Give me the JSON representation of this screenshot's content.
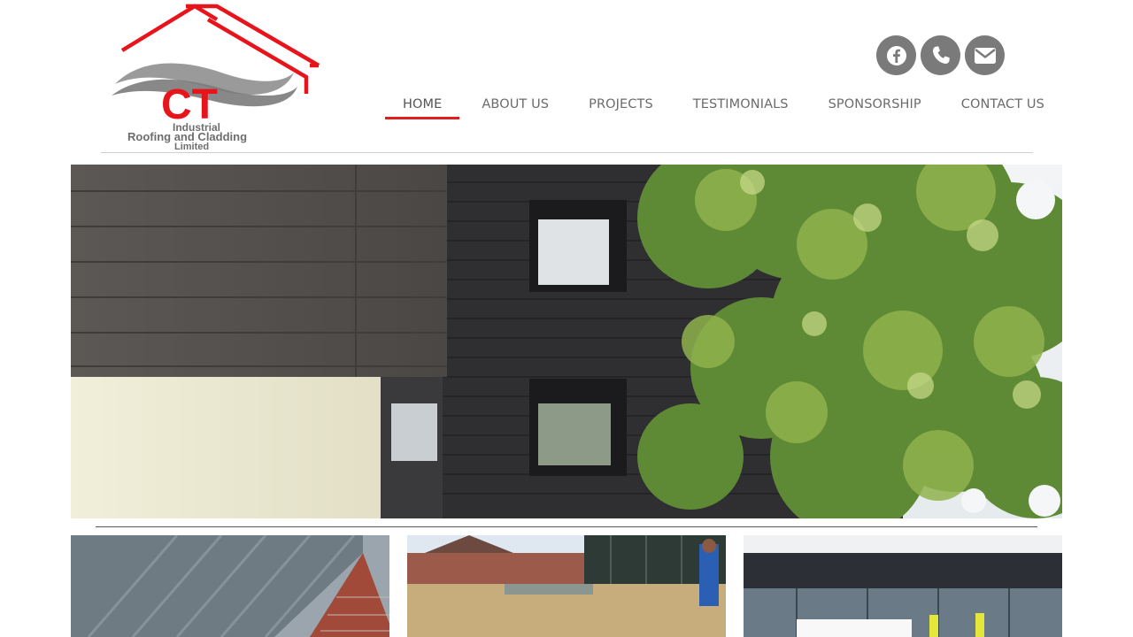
{
  "logo": {
    "brand": "CT",
    "line1": "Industrial",
    "line2": "Roofing and Cladding",
    "line3": "Limited",
    "colors": {
      "roof": "#e8141b",
      "swoosh": "#8a8a8a",
      "text": "#6e6e6e"
    }
  },
  "social": [
    {
      "name": "facebook",
      "icon": "facebook-icon"
    },
    {
      "name": "phone",
      "icon": "phone-icon"
    },
    {
      "name": "email",
      "icon": "envelope-icon"
    }
  ],
  "nav": {
    "items": [
      {
        "label": "HOME",
        "active": true
      },
      {
        "label": "ABOUT US"
      },
      {
        "label": "PROJECTS"
      },
      {
        "label": "TESTIMONIALS"
      },
      {
        "label": "SPONSORSHIP"
      },
      {
        "label": "CONTACT US"
      }
    ],
    "active_color": "#e01e1e"
  },
  "hero": {
    "subject": "building-cladding-photo"
  },
  "gallery": [
    {
      "subject": "roof-panel-photo"
    },
    {
      "subject": "flat-roof-installation-photo"
    },
    {
      "subject": "commercial-building-photo"
    }
  ]
}
